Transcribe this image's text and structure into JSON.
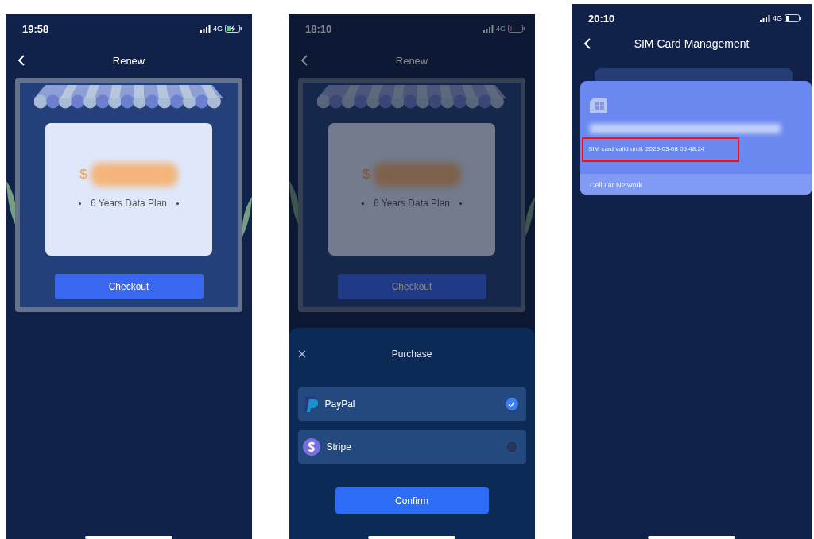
{
  "phones": [
    {
      "kind": "renew",
      "status_bar": {
        "time": "19:58",
        "network": "4G",
        "charging": true,
        "battery_low": false
      },
      "nav": {
        "title": "Renew"
      },
      "plan": {
        "currency": "$",
        "label": "6 Years Data Plan"
      },
      "checkout": "Checkout"
    },
    {
      "kind": "renew-purchase",
      "status_bar": {
        "time": "18:10",
        "network": "4G",
        "charging": false,
        "battery_low": true
      },
      "nav": {
        "title": "Renew"
      },
      "plan": {
        "currency": "$",
        "label": "6 Years Data Plan"
      },
      "checkout": "Checkout",
      "sheet": {
        "title": "Purchase",
        "methods": [
          {
            "kind": "paypal",
            "name": "PayPal",
            "selected": true
          },
          {
            "kind": "stripe",
            "name": "Stripe",
            "selected": false
          }
        ],
        "confirm": "Confirm"
      }
    },
    {
      "kind": "sim",
      "status_bar": {
        "time": "20:10",
        "network": "4G",
        "charging": false,
        "battery_low": false
      },
      "nav": {
        "title": "SIM Card Management"
      },
      "sim_card": {
        "validity": "SIM card valid until: 2029-03-08 05:48:24",
        "validity_highlighted": true,
        "network": "Cellular Network"
      }
    }
  ]
}
